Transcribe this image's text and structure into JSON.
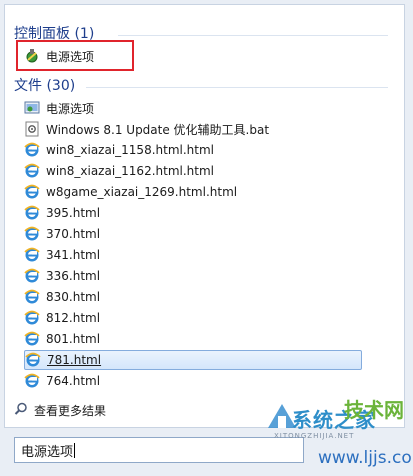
{
  "control_panel": {
    "header": "控制面板 (1)",
    "items": [
      {
        "label": "电源选项",
        "icon": "power-options-icon"
      }
    ]
  },
  "files": {
    "header": "文件 (30)",
    "items": [
      {
        "label": "电源选项",
        "icon": "control-panel-icon"
      },
      {
        "label": "Windows 8.1 Update 优化辅助工具.bat",
        "icon": "batch-file-icon"
      },
      {
        "label": "win8_xiazai_1158.html.html",
        "icon": "ie-icon"
      },
      {
        "label": "win8_xiazai_1162.html.html",
        "icon": "ie-icon"
      },
      {
        "label": "w8game_xiazai_1269.html.html",
        "icon": "ie-icon"
      },
      {
        "label": "395.html",
        "icon": "ie-icon"
      },
      {
        "label": "370.html",
        "icon": "ie-icon"
      },
      {
        "label": "341.html",
        "icon": "ie-icon"
      },
      {
        "label": "336.html",
        "icon": "ie-icon"
      },
      {
        "label": "830.html",
        "icon": "ie-icon"
      },
      {
        "label": "812.html",
        "icon": "ie-icon"
      },
      {
        "label": "801.html",
        "icon": "ie-icon"
      },
      {
        "label": "781.html",
        "icon": "ie-icon",
        "selected": true
      },
      {
        "label": "764.html",
        "icon": "ie-icon"
      }
    ]
  },
  "see_more": {
    "label": "查看更多结果",
    "icon": "search-icon"
  },
  "search": {
    "value": "电源选项"
  },
  "watermark": {
    "brand": "系统之家",
    "tag": "技术网",
    "sub": "XITONGZHIJIA.NET",
    "url": "www.ljjs.com"
  },
  "colors": {
    "accent": "#1e3e8c",
    "highlight": "#e0242c",
    "selection": "#d4e6fb",
    "ie_blue": "#2f8ad8"
  }
}
